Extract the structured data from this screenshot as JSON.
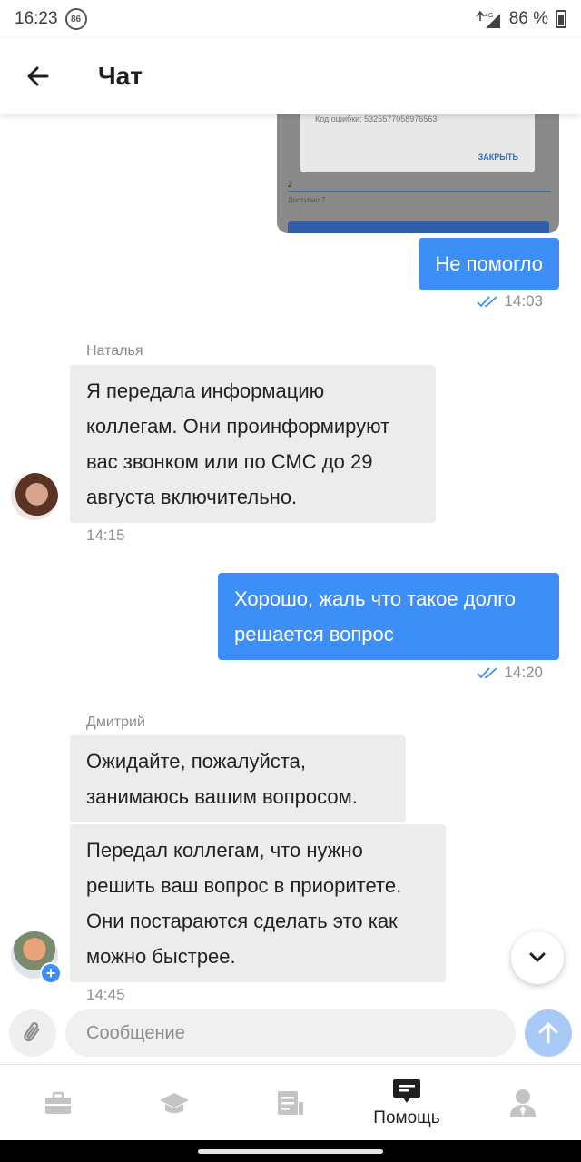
{
  "status_bar": {
    "time": "16:23",
    "notification_badge": "86",
    "network": "4G",
    "battery": "86 %"
  },
  "header": {
    "title": "Чат"
  },
  "screenshot_attachment": {
    "error_text": "Код ошибки: 5325577058976563",
    "close_label": "ЗАКРЫТЬ",
    "field_hint": "Доступно 2",
    "field_value": "2"
  },
  "messages": [
    {
      "direction": "out",
      "text": "Не помогло",
      "time": "14:03",
      "read": true
    },
    {
      "direction": "in",
      "sender": "Наталья",
      "text": "Я передала информацию коллегам. Они проинформируют вас звонком или по СМС до 29 августа включительно.",
      "time": "14:15"
    },
    {
      "direction": "out",
      "text": "Хорошо, жаль что такое долго решается вопрос",
      "time": "14:20",
      "read": true
    },
    {
      "direction": "in",
      "sender": "Дмитрий",
      "text": "Ожидайте, пожалуйста, занимаюсь вашим вопросом."
    },
    {
      "direction": "in",
      "sender": "Дмитрий",
      "text": "Передал коллегам, что нужно решить ваш вопрос в приоритете. Они постараются сделать это как можно быстрее.",
      "time": "14:45"
    }
  ],
  "input": {
    "placeholder": "Сообщение"
  },
  "bottom_nav": {
    "items": [
      {
        "icon": "briefcase-icon",
        "label": ""
      },
      {
        "icon": "graduation-cap-icon",
        "label": ""
      },
      {
        "icon": "document-icon",
        "label": ""
      },
      {
        "icon": "chat-icon",
        "label": "Помощь",
        "active": true
      },
      {
        "icon": "profile-icon",
        "label": ""
      }
    ]
  },
  "colors": {
    "accent": "#3e8ef7",
    "incoming_bubble": "#ececec",
    "send_disabled": "#a9c9f7"
  }
}
